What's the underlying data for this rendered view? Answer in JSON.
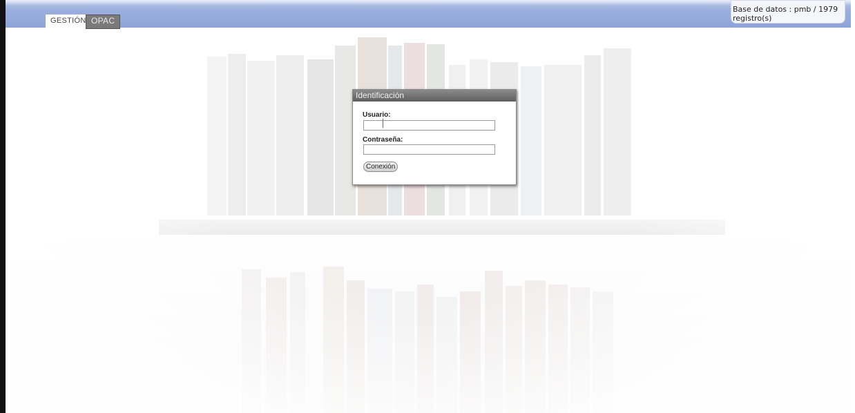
{
  "tabs": [
    {
      "label": "GESTIÓN",
      "active": true
    },
    {
      "label": "OPAC",
      "active": false
    }
  ],
  "db_info": "Base de datos : pmb / 1979 registro(s)",
  "login": {
    "title": "Identificación",
    "user_label": "Usuario:",
    "user_value": "",
    "password_label": "Contraseña:",
    "password_value": "",
    "submit_label": "Conexión"
  },
  "colors": {
    "topbar": "#9aaede",
    "dialog_title": "#6e6e6e"
  }
}
